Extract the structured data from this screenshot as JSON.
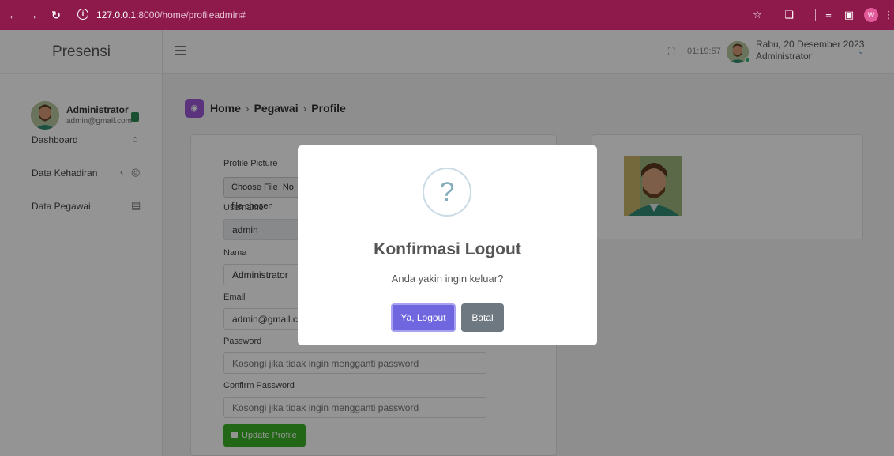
{
  "browser": {
    "url_host": "127.0.0.1",
    "url_path": ":8000/home/profileadmin#",
    "profile_initial": "W",
    "icons": [
      "back-icon",
      "forward-icon",
      "reload-icon",
      "site-info-icon",
      "star-icon",
      "extensions-icon",
      "media-icon",
      "sidepanel-icon",
      "menu-icon"
    ]
  },
  "sidebar": {
    "brand": "Presensi",
    "user_name": "Administrator",
    "user_email": "admin@gmail.com",
    "items": [
      {
        "label": "Dashboard",
        "icon": "home-icon"
      },
      {
        "label": "Data Kehadiran",
        "icon": "target-icon"
      },
      {
        "label": "Data Pegawai",
        "icon": "contact-book-icon"
      }
    ]
  },
  "header": {
    "clock": "01:19:57",
    "date": "Rabu, 20 Desember 2023",
    "role": "Administrator"
  },
  "breadcrumb": [
    "Home",
    "Pegawai",
    "Profile"
  ],
  "form": {
    "profile_picture_label": "Profile Picture",
    "choose_file_label": "Choose File",
    "choose_file_status": "No file chosen",
    "username_label": "Username",
    "username_value": "admin",
    "nama_label": "Nama",
    "nama_value": "Administrator",
    "email_label": "Email",
    "email_value": "admin@gmail.com",
    "password_label": "Password",
    "password_placeholder": "Kosongi jika tidak ingin mengganti password",
    "confirm_label": "Confirm Password",
    "confirm_placeholder": "Kosongi jika tidak ingin mengganti password",
    "submit_label": "Update Profile"
  },
  "modal": {
    "icon": "?",
    "title": "Konfirmasi Logout",
    "text": "Anda yakin ingin keluar?",
    "confirm_label": "Ya, Logout",
    "cancel_label": "Batal"
  },
  "colors": {
    "browser_bar": "#8e1a4c",
    "confirm_button": "#7066e0",
    "cancel_button": "#6e7881",
    "update_button": "#39b127"
  }
}
